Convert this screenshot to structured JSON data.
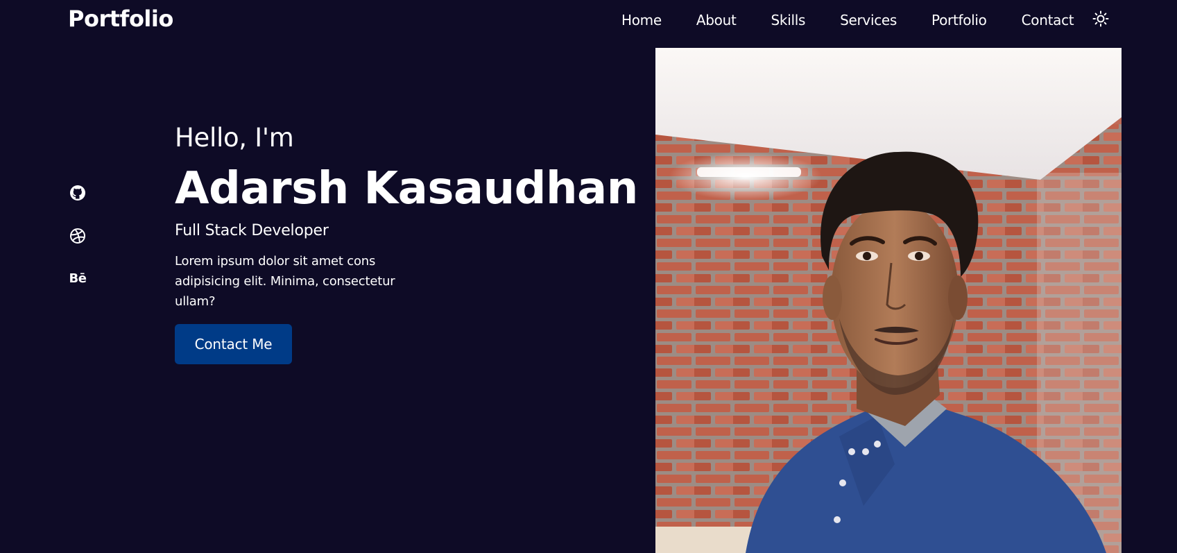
{
  "header": {
    "logo": "Portfolio",
    "nav": [
      "Home",
      "About",
      "Skills",
      "Services",
      "Portfolio",
      "Contact"
    ],
    "theme_icon": "sun-icon"
  },
  "social": [
    {
      "name": "github",
      "icon": "github-icon"
    },
    {
      "name": "dribbble",
      "icon": "dribbble-icon"
    },
    {
      "name": "behance",
      "icon": "behance-icon",
      "glyph": "Bē"
    }
  ],
  "hero": {
    "greeting": "Hello, I'm",
    "name": "Adarsh Kasaudhan",
    "role": "Full Stack Developer",
    "description": "Lorem ipsum dolor sit amet cons adipisicing elit. Minima, consectetur ullam?",
    "cta_label": "Contact Me"
  },
  "colors": {
    "background": "#0e0b26",
    "accent": "#003b87",
    "text": "#ffffff"
  }
}
